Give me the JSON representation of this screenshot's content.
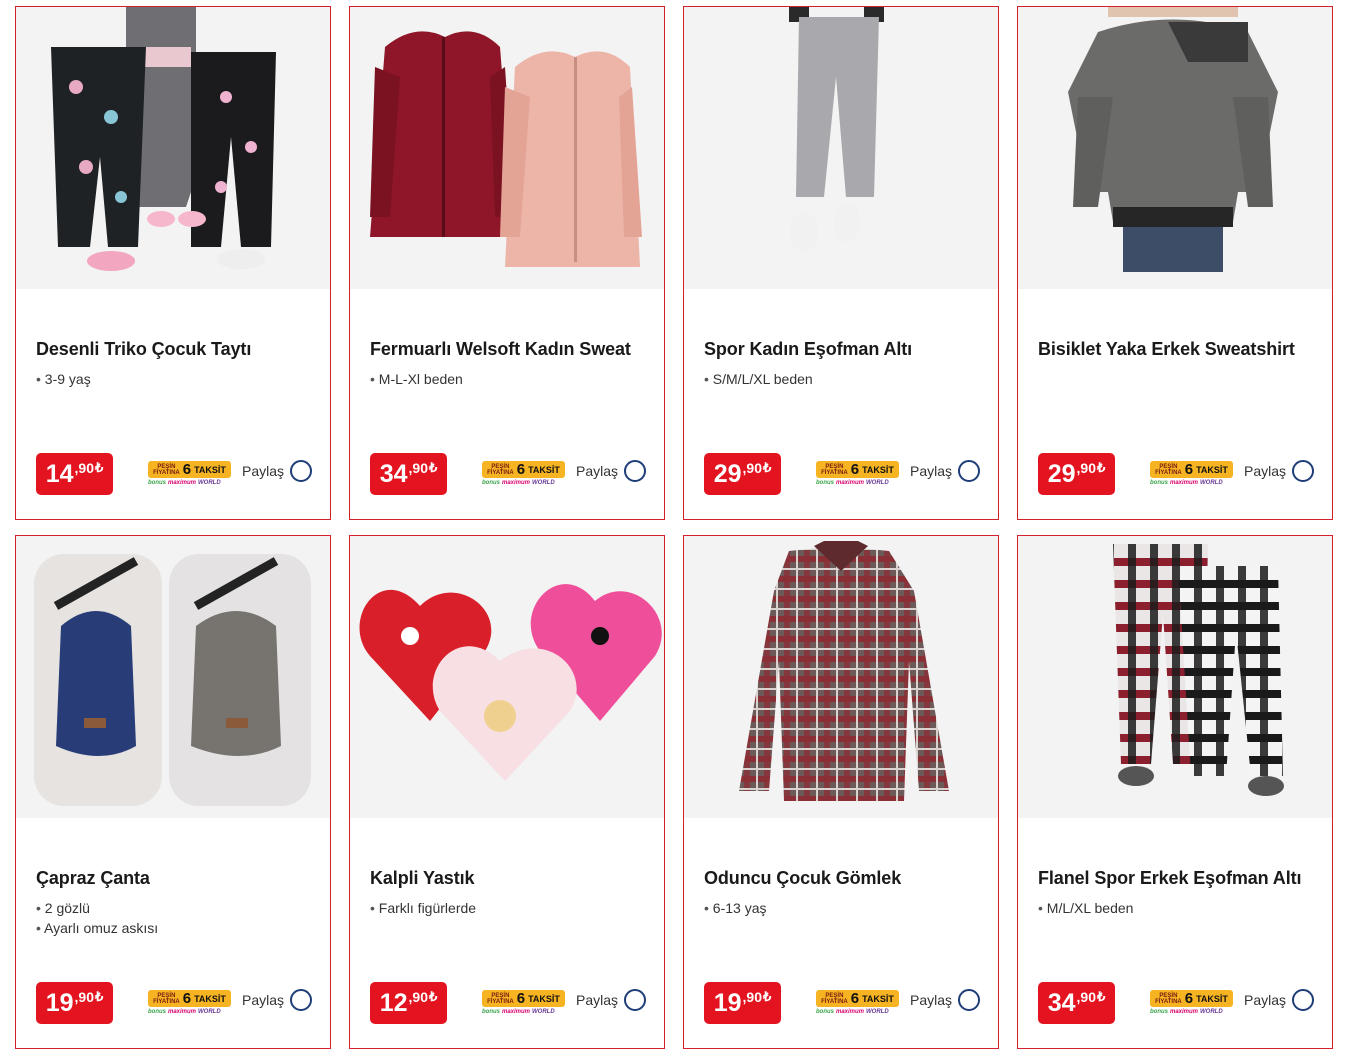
{
  "currency_symbol": "₺",
  "taksit": {
    "pesin_line1": "PEŞİN",
    "pesin_line2": "FİYATINA",
    "number": "6",
    "word": "TAKSİT",
    "card_bonus": "bonus",
    "card_maximum": "maximum",
    "card_world": "WORLD"
  },
  "share_label": "Paylaş",
  "products": [
    {
      "title": "Desenli Triko Çocuk Taytı",
      "features": [
        "3-9 yaş"
      ],
      "price_main": "14",
      "price_cents": ",90"
    },
    {
      "title": "Fermuarlı Welsoft Kadın Sweat",
      "features": [
        "M-L-Xl beden"
      ],
      "price_main": "34",
      "price_cents": ",90"
    },
    {
      "title": "Spor Kadın Eşofman Altı",
      "features": [
        "S/M/L/XL beden"
      ],
      "price_main": "29",
      "price_cents": ",90"
    },
    {
      "title": "Bisiklet Yaka Erkek Sweatshirt",
      "features": [],
      "price_main": "29",
      "price_cents": ",90"
    },
    {
      "title": "Çapraz Çanta",
      "features": [
        "2 gözlü",
        "Ayarlı omuz askısı"
      ],
      "price_main": "19",
      "price_cents": ",90"
    },
    {
      "title": "Kalpli Yastık",
      "features": [
        "Farklı figürlerde"
      ],
      "price_main": "12",
      "price_cents": ",90"
    },
    {
      "title": "Oduncu Çocuk Gömlek",
      "features": [
        "6-13 yaş"
      ],
      "price_main": "19",
      "price_cents": ",90"
    },
    {
      "title": "Flanel Spor Erkek Eşofman Altı",
      "features": [
        "M/L/XL beden"
      ],
      "price_main": "34",
      "price_cents": ",90"
    }
  ],
  "colors": {
    "card_border": "#d3202a",
    "price_bg": "#e3141f",
    "taksit_bg": "#f6b322",
    "share_circle": "#1f3d78"
  }
}
